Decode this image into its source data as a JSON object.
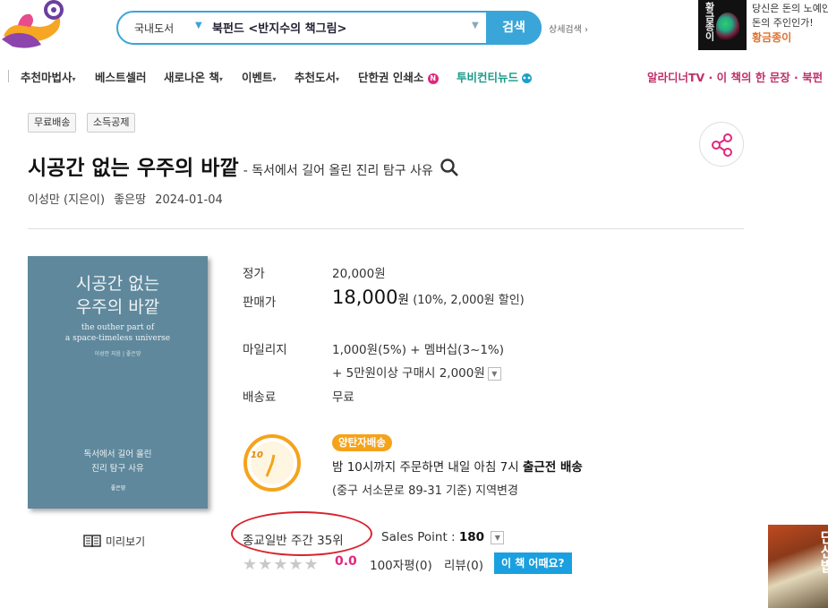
{
  "search": {
    "category": "국내도서",
    "query": "북펀드 <반지수의 책그림>",
    "button_label": "검색",
    "advanced_label": "상세검색 ›"
  },
  "banner": {
    "book_title": "황금종이",
    "text_line1": "당신은 돈의 노예인",
    "text_line2": "돈의 주인인가!",
    "brand": "황금종이"
  },
  "nav": {
    "items": [
      {
        "label": "추천마법사",
        "caret": "▾"
      },
      {
        "label": "베스트셀러",
        "caret": ""
      },
      {
        "label": "새로나온 책",
        "caret": "▾"
      },
      {
        "label": "이벤트",
        "caret": "▾"
      },
      {
        "label": "추천도서",
        "caret": "▾"
      },
      {
        "label": "단한권 인쇄소",
        "badge": "N"
      },
      {
        "label": "투비컨티뉴드",
        "badge": "•••"
      }
    ],
    "right_text": "알라디너TV · 이 책의 한 문장 · 북펀"
  },
  "tags": [
    "무료배송",
    "소득공제"
  ],
  "book": {
    "title": "시공간 없는 우주의 바깥",
    "subtitle": "- 독서에서 길어 올린 진리 탐구 사유",
    "author": "이성만 (지은이)",
    "publisher": "좋은땅",
    "date": "2024-01-04"
  },
  "cover": {
    "title_line1": "시공간 없는",
    "title_line2": "우주의 바깥",
    "en_line1": "the outher part of",
    "en_line2": "a space-timeless universe",
    "author_line": "이성만 지음 | 좋은땅",
    "sub_line1": "독서에서 길어 올린",
    "sub_line2": "진리 탐구 사유",
    "publisher_mark": "좋은땅"
  },
  "preview_label": "미리보기",
  "price": {
    "list_label": "정가",
    "list_value": "20,000원",
    "sale_label": "판매가",
    "sale_number": "18,000",
    "sale_unit": "원",
    "sale_discount": "(10%, 2,000원 할인)",
    "mileage_label": "마일리지",
    "mileage_line1": "1,000원(5%) + 멤버십(3~1%)",
    "mileage_line2": "+ 5만원이상 구매시 2,000원",
    "shipping_label": "배송료",
    "shipping_value": "무료"
  },
  "delivery": {
    "clock_number": "10",
    "badge": "양탄자배송",
    "line1_prefix": "밤 10시까지 주문하면 내일 아침 7시",
    "line1_bold": "출근전 배송",
    "line2": "(중구 서소문로 89-31 기준) 지역변경"
  },
  "stats": {
    "bestseller": "종교일반 주간 35위",
    "sales_point_label": "Sales Point :",
    "sales_point_value": "180",
    "stars": "★★★★★",
    "rating": "0.0",
    "reviews_100": "100자평(0)",
    "reviews": "리뷰(0)",
    "ask_button": "이 책 어때요?"
  },
  "side_ad": {
    "title": "단신밥"
  },
  "colors": {
    "accent": "#3aa5d8",
    "pink": "#e0287d",
    "orange": "#f5a31a",
    "red_circle": "#d8232f"
  }
}
